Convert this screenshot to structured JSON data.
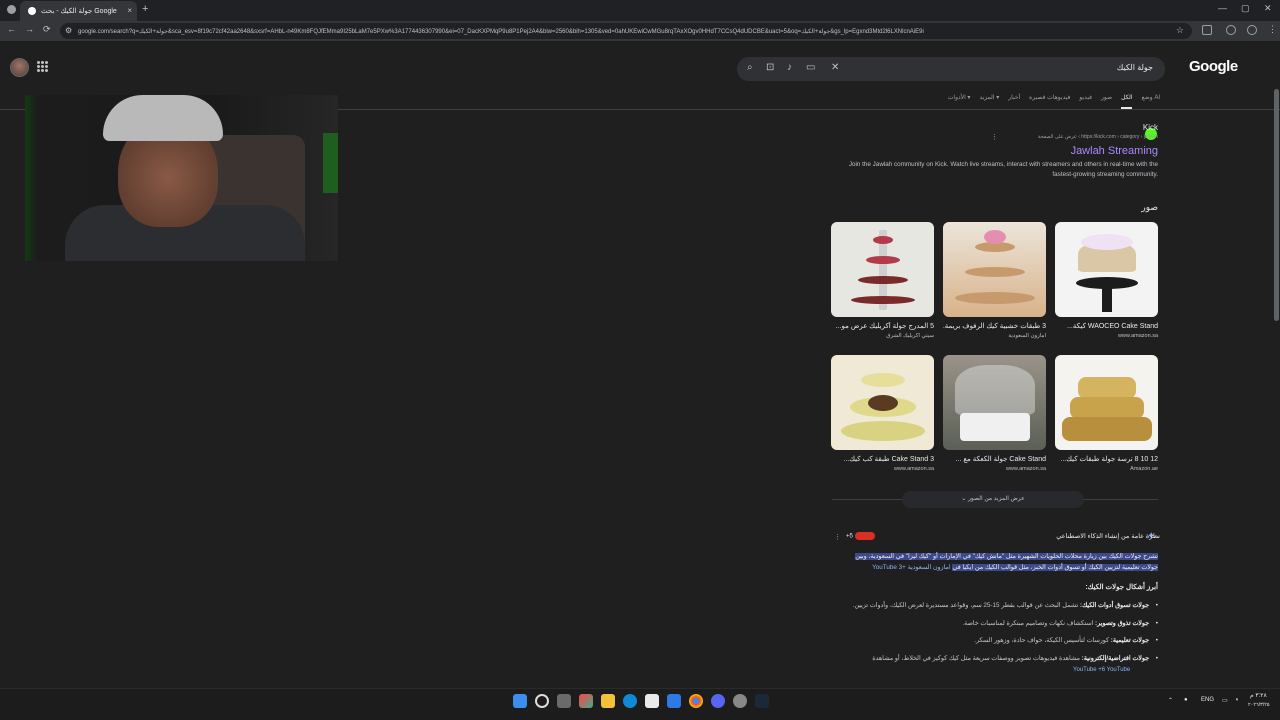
{
  "browser": {
    "tab_title": "جولة الكيك - بحث Google",
    "tab_close": "×",
    "new_tab": "+",
    "window_controls": [
      "—",
      "▢",
      "✕"
    ],
    "nav": {
      "back": "←",
      "forward": "→",
      "reload": "⟳"
    },
    "url": "google.com/search?q=جولة+الكيك&sca_esv=8f19c72cf42aa2648&sxsrf=AHbL-n49Km8FQJfEMma9I25bLaM7e5PXw%3A1774436307990&ei=07_DacKXPMqP9u8P1Pej2A4&biw=2560&bih=1305&ved=0ahUKEwiCwMGu8rqTAxXOgv0HHdT7CCsQ4dUDCBE&uact=5&oq=جولة+الكيك&gs_lp=Egxnd3Mtd2l6LXNlcnAiE9i",
    "bookmark_star": "☆"
  },
  "google": {
    "logo": "Google",
    "search_value": "جولة الكيك",
    "tabs": [
      "وضع AI",
      "الكل",
      "صور",
      "فيديو",
      "فيديوهات قصيرة",
      "أخبار",
      "المزيد ▾",
      "الأدوات ▾"
    ],
    "active_tab": "الكل"
  },
  "result1": {
    "site": "Kick",
    "url": "https://kick.com › category › jawlah › عرض على الصفحة",
    "title": "Jawlah Streaming",
    "snippet": "Join the Jawlah community on Kick. Watch live streams, interact with streamers and others in real-time with the fastest-growing streaming community.",
    "more": "⋮"
  },
  "images": {
    "heading": "صور",
    "items": [
      {
        "caption": "WAOCEO Cake Stand كيكة...",
        "source": "www.amazon.sa"
      },
      {
        "caption": "3 طبقات خشبية كيك الرفوف بريمة...",
        "source": "امازون السعودية"
      },
      {
        "caption": "5 المدرج جولة أكريليك عرض مو...",
        "source": "سيتي اكريليك الشرق"
      },
      {
        "caption": "12 10 8 ترسة جولة طبقات كيك...",
        "source": "Amazon.ae"
      },
      {
        "caption": "Cake Stand جولة الكعكة مع ...",
        "source": "www.amazon.sa"
      },
      {
        "caption": "Cake Stand 3 طبقة كب كيك...",
        "source": "www.amazon.sa"
      }
    ],
    "more_button": "عرض المزيد من الصور ⌄"
  },
  "ai": {
    "header": "نظرة عامة من إنشاء الذكاء الاصطناعي",
    "badges": "+5",
    "para_hl": "تشرح جولات الكيك بين زيارة محلات الحلويات الشهيرة مثل \"مانش كيك\" في الإمارات أو \"كيك ليزا\" في السعودية، وبين جولات تعليمية لتزيين الكيك أو تسوق أدوات الخبز، مثل قوالب الكيك من ايكيا في",
    "para_tail": "امازون السعودية +YouTube 3",
    "subhead": "أبرز أشكال جولات الكيك:",
    "list": [
      {
        "b": "جولات تسوق أدوات الكيك:",
        "t": " تشمل البحث عن قوالب بقطر 15-25 سم، وقواعد مستديرة لعرض الكيك، وأدوات تزيين."
      },
      {
        "b": "جولات تذوق وتصوير:",
        "t": " استكشاف نكهات وتصاميم مبتكرة لمناسبات خاصة."
      },
      {
        "b": "جولات تعليمية:",
        "t": " كورسات لتأسيس الكيكة، حواف حادة، وزهور السكر."
      },
      {
        "b": "جولات افتراضية/إلكترونية:",
        "t": " مشاهدة فيديوهات تصوير ووصفات سريعة مثل كيك كوكيز في الخلاط، أو مشاهدة"
      }
    ],
    "yt": "YouTube +6 YouTube"
  },
  "taskbar": {
    "lang": "ENG",
    "time": "٣:٢٨ م",
    "date": "٢٠٢٦/٣/٢٥"
  }
}
